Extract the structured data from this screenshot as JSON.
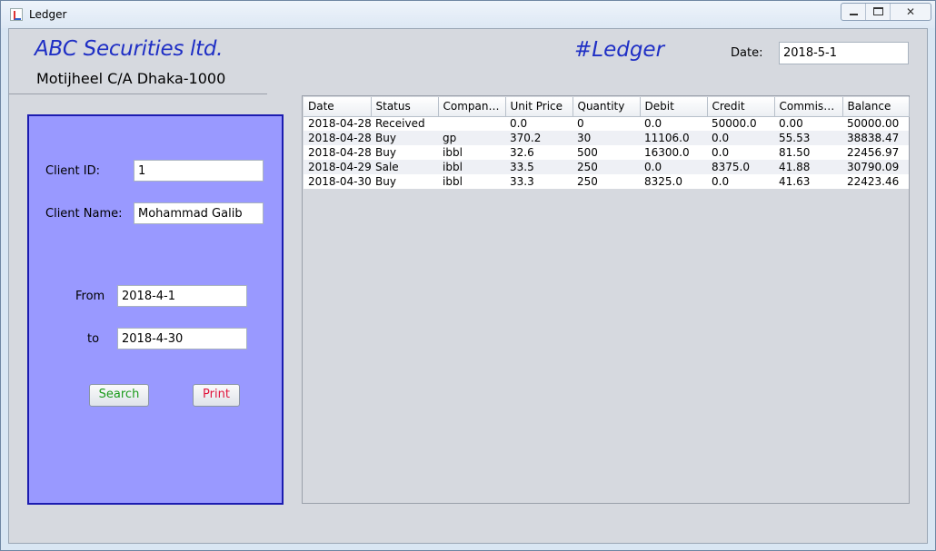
{
  "window": {
    "title": "Ledger",
    "controls": {
      "minimize": "minimize",
      "maximize": "maximize",
      "close": "✕"
    }
  },
  "header": {
    "company_name": "ABC Securities ltd.",
    "address": "Motijheel C/A Dhaka-1000",
    "page_title": "#Ledger",
    "date_label": "Date:",
    "date_value": "2018-5-1"
  },
  "filters": {
    "client_id_label": "Client ID:",
    "client_id_value": "1",
    "client_name_label": "Client Name:",
    "client_name_value": "Mohammad Galib",
    "from_label": "From",
    "from_value": "2018-4-1",
    "to_label": "to",
    "to_value": "2018-4-30",
    "search_label": "Search",
    "print_label": "Print"
  },
  "colors": {
    "brand": "#1f2fc5",
    "panel": "#9999ff",
    "search": "#1a9a1a",
    "print": "#e0143c"
  },
  "ledger": {
    "columns": [
      "Date",
      "Status",
      "Company...",
      "Unit Price",
      "Quantity",
      "Debit",
      "Credit",
      "Commiss...",
      "Balance"
    ],
    "rows": [
      [
        "2018-04-28",
        "Received",
        "",
        "0.0",
        "0",
        "0.0",
        "50000.0",
        "0.00",
        "50000.00"
      ],
      [
        "2018-04-28",
        "Buy",
        "gp",
        "370.2",
        "30",
        "11106.0",
        "0.0",
        "55.53",
        "38838.47"
      ],
      [
        "2018-04-28",
        "Buy",
        "ibbl",
        "32.6",
        "500",
        "16300.0",
        "0.0",
        "81.50",
        "22456.97"
      ],
      [
        "2018-04-29",
        "Sale",
        "ibbl",
        "33.5",
        "250",
        "0.0",
        "8375.0",
        "41.88",
        "30790.09"
      ],
      [
        "2018-04-30",
        "Buy",
        "ibbl",
        "33.3",
        "250",
        "8325.0",
        "0.0",
        "41.63",
        "22423.46"
      ]
    ]
  }
}
